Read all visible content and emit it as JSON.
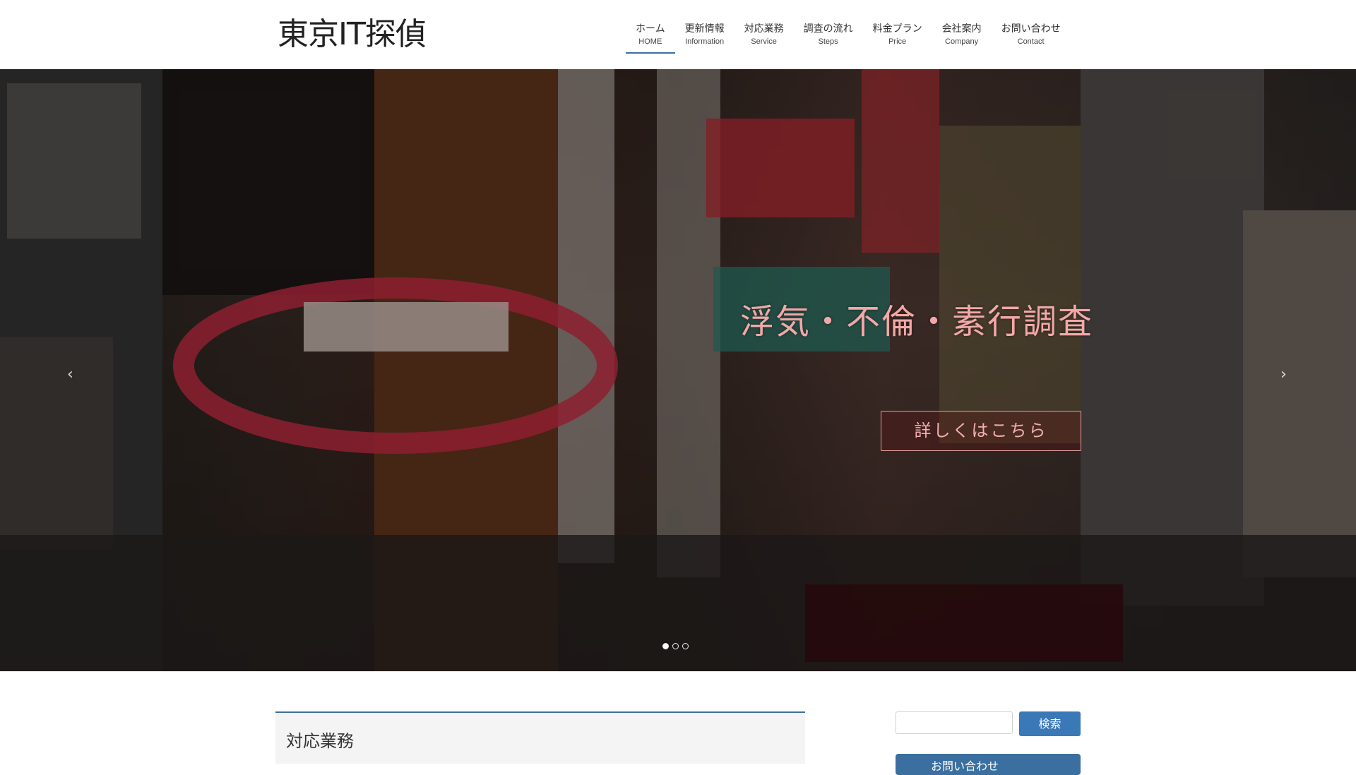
{
  "site": {
    "logo": "東京IT探偵"
  },
  "nav": [
    {
      "jp": "ホーム",
      "en": "HOME"
    },
    {
      "jp": "更新情報",
      "en": "Information"
    },
    {
      "jp": "対応業務",
      "en": "Service"
    },
    {
      "jp": "調査の流れ",
      "en": "Steps"
    },
    {
      "jp": "料金プラン",
      "en": "Price"
    },
    {
      "jp": "会社案内",
      "en": "Company"
    },
    {
      "jp": "お問い合わせ",
      "en": "Contact"
    }
  ],
  "hero": {
    "title": "浮気・不倫・素行調査",
    "button": "詳しくはこちら",
    "prev": "‹",
    "next": "›",
    "slide_count": 3,
    "active_slide": 1
  },
  "content": {
    "section_title": "対応業務"
  },
  "sidebar": {
    "search_button": "検索",
    "contact_label": "お問い合わせ"
  },
  "colors": {
    "accent": "#3a6fa0",
    "button": "#3a78b8",
    "hero_text": "#f3a8a8"
  }
}
